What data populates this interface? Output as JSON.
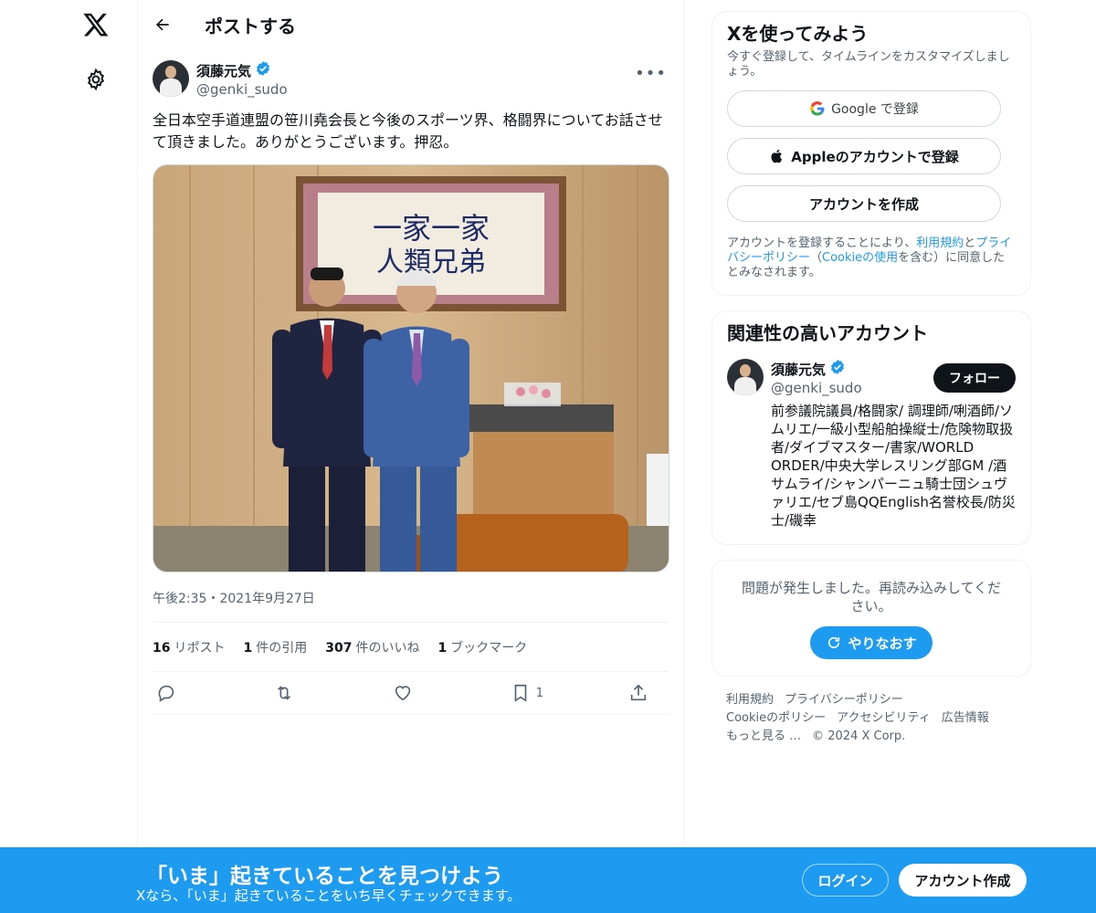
{
  "header": {
    "title": "ポストする"
  },
  "post": {
    "author_name": "須藤元気",
    "author_handle": "@genki_sudo",
    "text": "全日本空手道連盟の笹川堯会長と今後のスポーツ界、格闘界についてお話させて頂きました。ありがとうございます。押忍。",
    "timestamp": "午後2:35・2021年9月27日",
    "stats": {
      "reposts_count": "16",
      "reposts_label": "リポスト",
      "quotes_count": "1",
      "quotes_label": "件の引用",
      "likes_count": "307",
      "likes_label": "件のいいね",
      "bookmarks_count": "1",
      "bookmarks_label": "ブックマーク"
    },
    "actions": {
      "bookmark_count": "1"
    }
  },
  "signup_card": {
    "title": "Xを使ってみよう",
    "subtitle": "今すぐ登録して、タイムラインをカスタマイズしましょう。",
    "google_label": "Google で登録",
    "apple_label": "Appleのアカウントで登録",
    "create_label": "アカウントを作成",
    "legal_1": "アカウントを登録することにより、",
    "legal_terms": "利用規約",
    "legal_2": "と",
    "legal_privacy": "プライバシーポリシー",
    "legal_3": "（",
    "legal_cookie": "Cookieの使用",
    "legal_4": "を含む）に同意したとみなされます。"
  },
  "related": {
    "title": "関連性の高いアカウント",
    "name": "須藤元気",
    "handle": "@genki_sudo",
    "follow_label": "フォロー",
    "bio": "前参議院議員/格闘家/ 調理師/唎酒師/ソムリエ/一級小型船舶操縦士/危険物取扱者/ダイブマスター/書家/WORLD ORDER/中央大学レスリング部GM /酒サムライ/シャンパーニュ騎士団シュヴァリエ/セブ島QQEnglish名誉校長/防災士/磯幸"
  },
  "error_card": {
    "message": "問題が発生しました。再読み込みしてください。",
    "retry_label": "やりなおす"
  },
  "footer": {
    "terms": "利用規約",
    "privacy": "プライバシーポリシー",
    "cookie": "Cookieのポリシー",
    "accessibility": "アクセシビリティ",
    "ads": "広告情報",
    "more": "もっと見る …",
    "copyright": "© 2024 X Corp."
  },
  "banner": {
    "title": "「いま」起きていることを見つけよう",
    "subtitle": "Xなら、「いま」起きていることをいち早くチェックできます。",
    "login_label": "ログイン",
    "signup_label": "アカウント作成"
  },
  "photo": {
    "calligraphy": "一家一家 人類兄弟"
  },
  "colors": {
    "accent": "#1d9bf0",
    "text": "#0f1419",
    "muted": "#536471",
    "verified": "#1d9bf0"
  }
}
